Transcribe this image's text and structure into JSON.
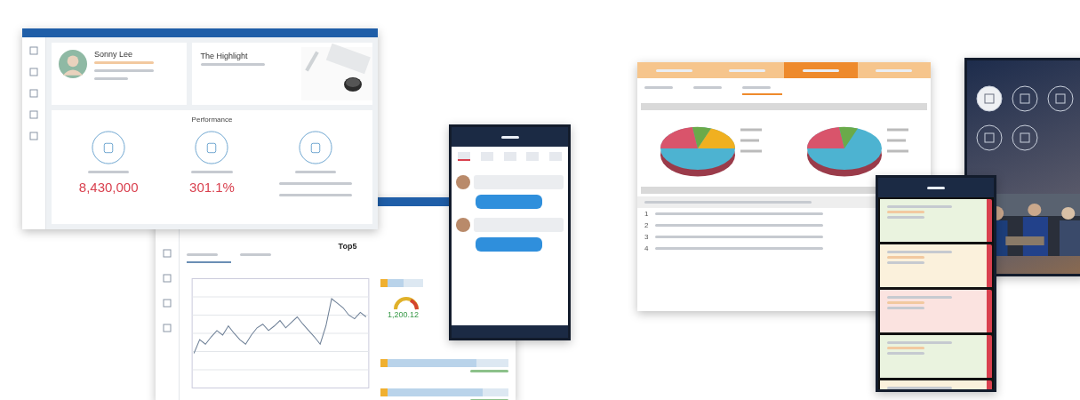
{
  "dashboard": {
    "user_name": "Sonny Lee",
    "highlight_title": "The Highlight",
    "performance_title": "Performance",
    "metrics": [
      {
        "kind": "number",
        "value": "8,430,000"
      },
      {
        "kind": "number",
        "value": "301.1%"
      },
      {
        "kind": "note"
      }
    ]
  },
  "analytics": {
    "title": "Top5",
    "tabs": [
      {
        "selected": true
      },
      {
        "selected": false
      }
    ],
    "gauge_value": "1,200.12",
    "bars": [
      {
        "level": 0.55
      },
      {
        "level": 0.75
      },
      {
        "level": 0.8
      }
    ]
  },
  "chat_phone": {
    "tabs": [
      {
        "selected": true
      },
      {
        "selected": false
      },
      {
        "selected": false
      },
      {
        "selected": false
      },
      {
        "selected": false
      }
    ],
    "messages": [
      {
        "kind": "thread"
      },
      {
        "kind": "thread"
      }
    ]
  },
  "tablet": {
    "steps": [
      {
        "selected": false
      },
      {
        "selected": false
      },
      {
        "selected": true
      },
      {
        "selected": false
      }
    ],
    "subtabs": [
      {
        "selected": false
      },
      {
        "selected": false
      },
      {
        "selected": true
      }
    ],
    "rows": [
      {
        "index": "1"
      },
      {
        "index": "2"
      },
      {
        "index": "3"
      },
      {
        "index": "4"
      }
    ]
  },
  "menu_phone": {
    "icons": [
      {
        "selected": true
      },
      {
        "selected": false
      },
      {
        "selected": false
      },
      {
        "selected": false
      },
      {
        "selected": false
      }
    ]
  },
  "list_phone": {
    "cards": [
      {
        "color": "#eaf3df"
      },
      {
        "color": "#fbf1dc"
      },
      {
        "color": "#fbe3e0"
      },
      {
        "color": "#eaf3df"
      },
      {
        "color": "#fbf1dc"
      }
    ]
  }
}
